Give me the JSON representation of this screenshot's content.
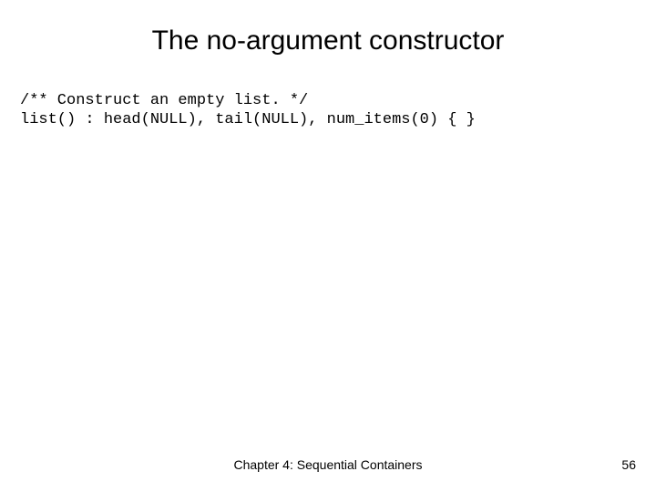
{
  "title": "The no-argument constructor",
  "code": {
    "line1": "/** Construct an empty list. */",
    "line2": "list() : head(NULL), tail(NULL), num_items(0) { }"
  },
  "footer": {
    "chapter": "Chapter 4: Sequential Containers",
    "page": "56"
  }
}
